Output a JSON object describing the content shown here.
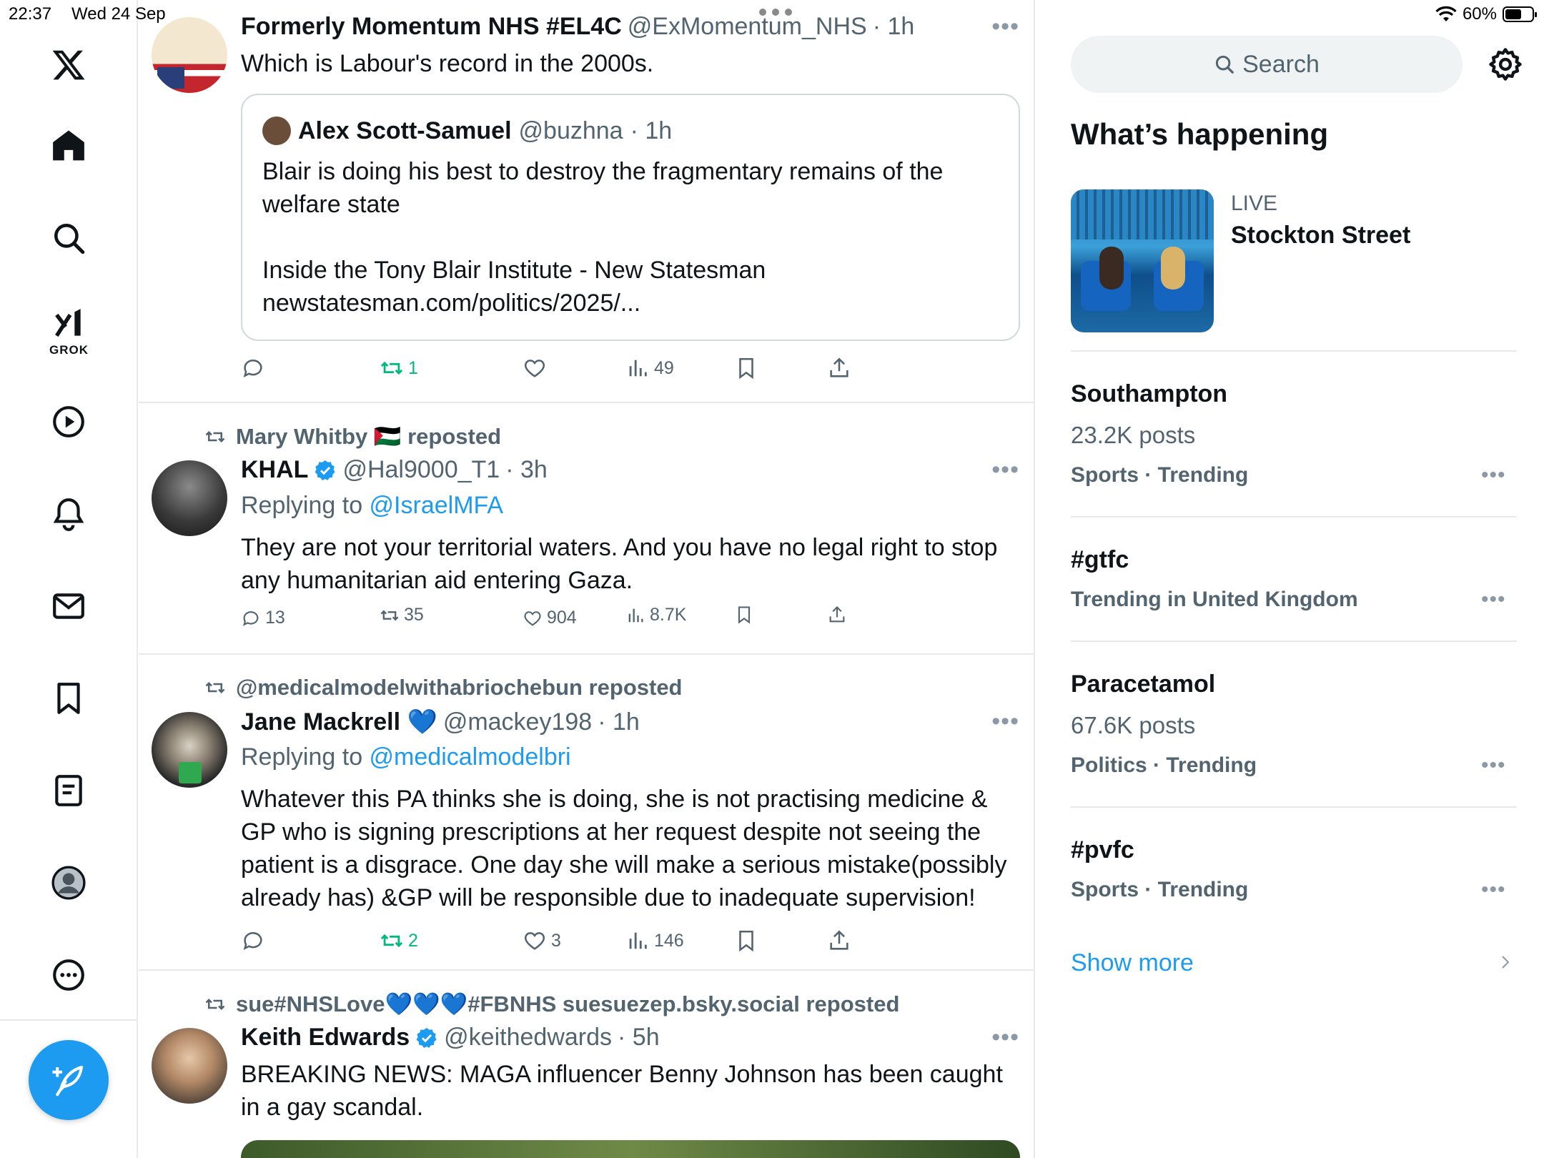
{
  "status_bar": {
    "time": "22:37",
    "date": "Wed 24 Sep",
    "battery": "60%",
    "battery_level": 0.6
  },
  "nav": {
    "grok_label": "GROK"
  },
  "feed": {
    "posts": [
      {
        "author": "Formerly Momentum NHS #EL4C",
        "handle": "@ExMomentum_NHS",
        "time": "· 1h",
        "text": "Which is Labour's record in the 2000s.",
        "quote": {
          "author": "Alex Scott-Samuel",
          "handle": "@buzhna",
          "time": "· 1h",
          "text1": "Blair is doing his best to destroy the fragmentary remains of the welfare state",
          "text2": "Inside the Tony Blair Institute - New Statesman",
          "text3": "newstatesman.com/politics/2025/..."
        },
        "reposts": "1",
        "views": "49"
      },
      {
        "reposted_by": "Mary Whitby 🇵🇸 reposted",
        "author": "KHAL",
        "handle": "@Hal9000_T1",
        "time": "· 3h",
        "replying_prefix": "Replying to ",
        "replying_to": "@IsraelMFA",
        "text": "They are not your territorial waters. And you have no legal right to stop any humanitarian aid entering Gaza.",
        "replies": "13",
        "reposts": "35",
        "likes": "904",
        "views": "8.7K"
      },
      {
        "reposted_by": "@medicalmodelwithabriochebun reposted",
        "author": "Jane Mackrell 💙",
        "handle": "@mackey198",
        "time": "· 1h",
        "replying_prefix": "Replying to ",
        "replying_to": "@medicalmodelbri",
        "text": "Whatever this PA thinks she is doing, she is not practising medicine & GP who is signing prescriptions at her request despite not seeing the patient is a disgrace. One day she will make a serious mistake(possibly already has) &GP will be responsible due to inadequate supervision!",
        "reposts": "2",
        "likes": "3",
        "views": "146"
      },
      {
        "reposted_by": "sue#NHSLove💙💙💙#FBNHS suesuezep.bsky.social reposted",
        "author": "Keith Edwards",
        "handle": "@keithedwards",
        "time": "· 5h",
        "text": "BREAKING NEWS: MAGA influencer Benny Johnson has been caught in a gay scandal."
      }
    ]
  },
  "sidebar": {
    "search_placeholder": "Search",
    "heading": "What’s happening",
    "live": {
      "tag": "LIVE",
      "title": "Stockton Street"
    },
    "trends": [
      {
        "title": "Southampton",
        "posts": "23.2K posts",
        "meta": "Sports · Trending"
      },
      {
        "title": "#gtfc",
        "meta": "Trending in United Kingdom"
      },
      {
        "title": "Paracetamol",
        "posts": "67.6K posts",
        "meta": "Politics · Trending"
      },
      {
        "title": "#pvfc",
        "meta": "Sports · Trending"
      }
    ],
    "show_more": "Show more"
  }
}
